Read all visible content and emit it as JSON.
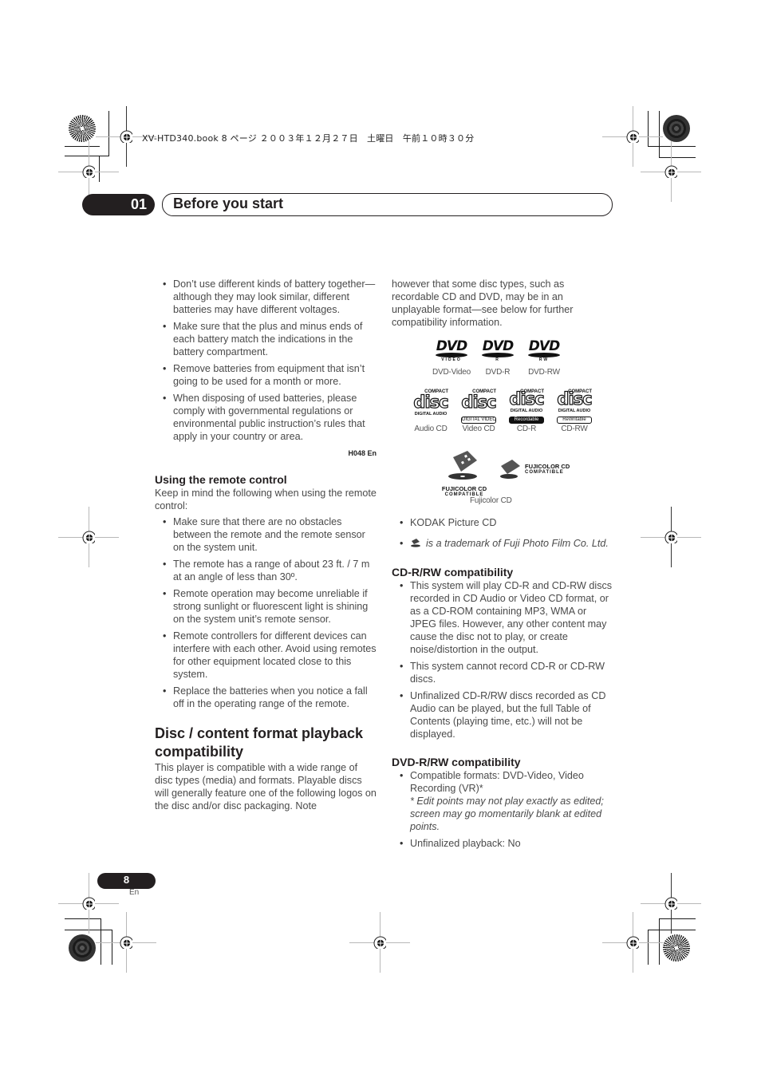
{
  "slug": "XV-HTD340.book  8 ページ  ２００３年１２月２７日　土曜日　午前１０時３０分",
  "header": {
    "chapter_number": "01",
    "chapter_title": "Before you start"
  },
  "left_column": {
    "battery_bullets": [
      "Don’t use different kinds of battery together—although they may look similar, different batteries may have different voltages.",
      "Make sure that the plus and minus ends of each battery match the indications in the battery compartment.",
      "Remove batteries from equipment that isn’t going to be used for a month or more.",
      "When disposing of used batteries, please comply with governmental regulations or environmental public instruction’s rules that apply in your country or area."
    ],
    "note_code": "H048 En",
    "remote_section": {
      "heading": "Using the remote control",
      "intro": "Keep in mind the following when using the remote control:",
      "bullets": [
        "Make sure that there are no obstacles between the remote and the remote sensor on the system unit.",
        "The remote has a range of about 23 ft. / 7 m at an angle of less than 30º.",
        "Remote operation may become unreliable if strong sunlight or fluorescent light is shining on the system unit’s remote sensor.",
        "Remote controllers for different devices can interfere with each other. Avoid using remotes for other equipment located close to this system.",
        "Replace the batteries when you notice a fall off in the operating range of the remote."
      ]
    },
    "disc_section": {
      "heading": "Disc / content format playback compatibility",
      "intro": "This player is compatible with a wide range of disc types (media) and formats. Playable discs will generally feature one of the following logos on the disc and/or disc packaging. Note"
    }
  },
  "right_column": {
    "intro_continued": "however that some disc types, such as recordable CD and DVD, may be in an unplayable format—see below for further compatibility information.",
    "dvd_logos": [
      {
        "logo_text": "DVD",
        "sub": "VIDEO",
        "caption": "DVD-Video"
      },
      {
        "logo_text": "DVD",
        "sub": "R",
        "caption": "DVD-R"
      },
      {
        "logo_text": "DVD",
        "sub": "RW",
        "caption": "DVD-RW"
      }
    ],
    "cd_logos": [
      {
        "compact": "COMPACT",
        "disc": "disc",
        "label": "DIGITAL AUDIO",
        "box": "",
        "caption": "Audio CD"
      },
      {
        "compact": "COMPACT",
        "disc": "disc",
        "label": "",
        "box": "DIGITAL VIDEO",
        "caption": "Video CD"
      },
      {
        "compact": "COMPACT",
        "disc": "disc",
        "label": "DIGITAL AUDIO",
        "box": "Recordable",
        "caption": "CD-R"
      },
      {
        "compact": "COMPACT",
        "disc": "disc",
        "label": "DIGITAL AUDIO",
        "box": "ReWritable",
        "caption": "CD-RW"
      }
    ],
    "fujicolor": {
      "brand": "FUJICOLOR CD",
      "compatible": "COMPATIBLE",
      "caption": "Fujicolor CD"
    },
    "extra_bullets": {
      "kodak": "KODAK Picture CD",
      "trademark": "is a trademark of Fuji Photo Film Co. Ltd."
    },
    "cdrw_section": {
      "heading": "CD-R/RW compatibility",
      "bullets": [
        "This system will play CD-R and CD-RW discs recorded in CD Audio or Video CD format, or as a CD-ROM containing MP3, WMA or JPEG files. However, any other content may cause the disc not to play, or create noise/distortion in the output.",
        "This system cannot record CD-R or CD-RW discs.",
        "Unfinalized CD-R/RW discs recorded as CD Audio can be played, but the full Table of Contents (playing time, etc.) will not be displayed."
      ]
    },
    "dvdrw_section": {
      "heading": "DVD-R/RW compatibility",
      "formats_bullet": "Compatible formats: DVD-Video, Video Recording (VR)*",
      "formats_note": "* Edit points may not play exactly as edited; screen may go momentarily blank at edited points.",
      "unfinalized_bullet": "Unfinalized playback: No"
    }
  },
  "footer": {
    "page_number": "8",
    "language": "En"
  }
}
